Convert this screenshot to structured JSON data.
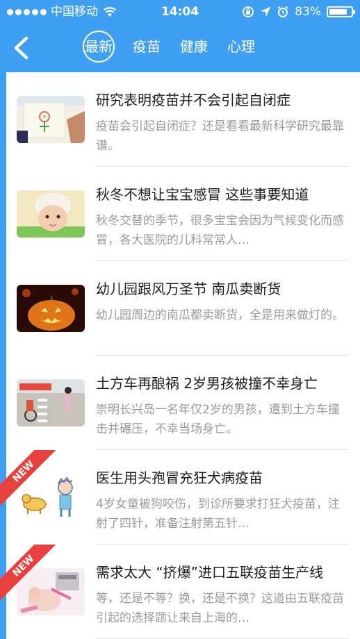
{
  "status": {
    "carrier": "中国移动",
    "time": "14:04",
    "battery_pct": "83%",
    "battery_level": 0.83,
    "icons": [
      "wifi-icon",
      "lock-rotation-icon",
      "location-arrow-icon",
      "alarm-icon",
      "battery-icon"
    ]
  },
  "nav": {
    "back_icon": "back-chevron-icon",
    "tabs": [
      {
        "label": "最新",
        "active": true
      },
      {
        "label": "疫苗",
        "active": false
      },
      {
        "label": "健康",
        "active": false
      },
      {
        "label": "心理",
        "active": false
      }
    ]
  },
  "articles": [
    {
      "title": "研究表明疫苗并不会引起自闭症",
      "summary": "疫苗会引起自闭症？还是看看最新科学研究最靠谱。",
      "thumb": "drawing-child-photo",
      "is_new": false
    },
    {
      "title": "秋冬不想让宝宝感冒 这些事要知道",
      "summary": "秋冬交替的季节，很多宝宝会因为气候变化而感冒，各大医院的儿科常常人…",
      "thumb": "baby-knit-hat-photo",
      "is_new": false
    },
    {
      "title": "幼儿园跟风万圣节 南瓜卖断货",
      "summary": "幼儿园周边的南瓜都卖断货，全是用来做灯的。",
      "thumb": "jack-o-lantern-photo",
      "is_new": false
    },
    {
      "title": "土方车再酿祸 2岁男孩被撞不幸身亡",
      "summary": "崇明长兴岛一名年仅2岁的男孩，遭到土方车撞击并碾压，不幸当场身亡。",
      "thumb": "street-crossing-photo",
      "is_new": false
    },
    {
      "title": "医生用头孢冒充狂犬病疫苗",
      "summary": "4岁女童被狗咬伤，到诊所要求打狂犬疫苗，注射了四针，准备注射第五针…",
      "thumb": "dog-boy-cartoon",
      "is_new": true,
      "badge": "NEW"
    },
    {
      "title": "需求太大 “挤爆”进口五联疫苗生产线",
      "summary": "等，还是不等？换，还是不换？这道由五联疫苗引起的选择题让来自上海的…",
      "thumb": "vaccination-photo",
      "is_new": true,
      "badge": "NEW"
    }
  ]
}
